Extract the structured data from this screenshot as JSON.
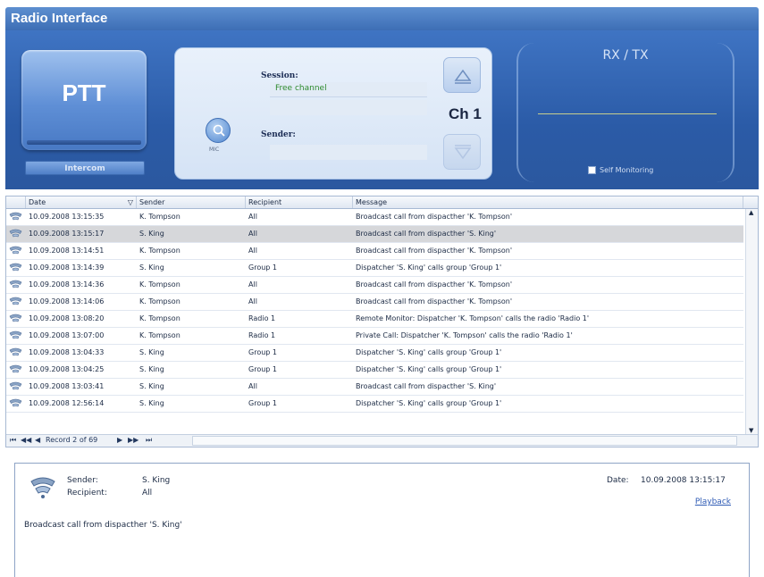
{
  "app": {
    "title": "Radio Interface"
  },
  "controls": {
    "ptt_label": "PTT",
    "intercom_label": "Intercom",
    "mic_label": "MIC",
    "session_label": "Session:",
    "session_value": "Free channel",
    "sender_label": "Sender:",
    "sender_value": "",
    "channel": "Ch 1",
    "rxtx_label": "RX / TX",
    "self_monitoring_label": "Self Monitoring",
    "self_monitoring_checked": false
  },
  "grid": {
    "columns": [
      "Date",
      "Sender",
      "Recipient",
      "Message"
    ],
    "sort_column": "Date",
    "rows": [
      {
        "date": "10.09.2008 13:15:35",
        "sender": "K. Tompson",
        "recipient": "All",
        "message": "Broadcast call from dispacther 'K. Tompson'",
        "selected": false
      },
      {
        "date": "10.09.2008 13:15:17",
        "sender": "S. King",
        "recipient": "All",
        "message": "Broadcast call from dispacther 'S. King'",
        "selected": true
      },
      {
        "date": "10.09.2008 13:14:51",
        "sender": "K. Tompson",
        "recipient": "All",
        "message": "Broadcast call from dispacther 'K. Tompson'",
        "selected": false
      },
      {
        "date": "10.09.2008 13:14:39",
        "sender": "S. King",
        "recipient": "Group 1",
        "message": "Dispatcher 'S. King' calls group 'Group 1'",
        "selected": false
      },
      {
        "date": "10.09.2008 13:14:36",
        "sender": "K. Tompson",
        "recipient": "All",
        "message": "Broadcast call from dispacther 'K. Tompson'",
        "selected": false
      },
      {
        "date": "10.09.2008 13:14:06",
        "sender": "K. Tompson",
        "recipient": "All",
        "message": "Broadcast call from dispacther 'K. Tompson'",
        "selected": false
      },
      {
        "date": "10.09.2008 13:08:20",
        "sender": "K. Tompson",
        "recipient": "Radio 1",
        "message": "Remote Monitor: Dispatcher 'K. Tompson' calls the radio 'Radio 1'",
        "selected": false
      },
      {
        "date": "10.09.2008 13:07:00",
        "sender": "K. Tompson",
        "recipient": "Radio 1",
        "message": "Private Call: Dispatcher 'K. Tompson' calls the radio 'Radio 1'",
        "selected": false
      },
      {
        "date": "10.09.2008 13:04:33",
        "sender": "S. King",
        "recipient": "Group 1",
        "message": "Dispatcher 'S. King' calls group 'Group 1'",
        "selected": false
      },
      {
        "date": "10.09.2008 13:04:25",
        "sender": "S. King",
        "recipient": "Group 1",
        "message": "Dispatcher 'S. King' calls group 'Group 1'",
        "selected": false
      },
      {
        "date": "10.09.2008 13:03:41",
        "sender": "S. King",
        "recipient": "All",
        "message": "Broadcast call from dispacther 'S. King'",
        "selected": false
      },
      {
        "date": "10.09.2008 12:56:14",
        "sender": "S. King",
        "recipient": "Group 1",
        "message": "Dispatcher 'S. King' calls group 'Group 1'",
        "selected": false
      }
    ],
    "navigator": {
      "record_text": "Record 2 of 69"
    }
  },
  "detail": {
    "sender_label": "Sender:",
    "sender_value": "S. King",
    "recipient_label": "Recipient:",
    "recipient_value": "All",
    "date_label": "Date:",
    "date_value": "10.09.2008 13:15:17",
    "playback_label": "Playback",
    "message": "Broadcast call from dispacther 'S. King'"
  },
  "colors": {
    "header_blue": "#2b5ba7",
    "selection": "#d6d7da",
    "link": "#2f5bb5"
  }
}
